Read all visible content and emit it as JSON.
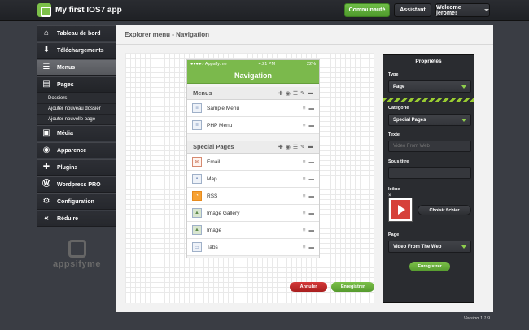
{
  "header": {
    "app_title": "My first IOS7 app",
    "community_label": "Communauté",
    "assistant_label": "Assistant",
    "welcome_label": "Welcome jerome!"
  },
  "sidebar": {
    "items": [
      {
        "label": "Tableau de bord",
        "icon": "home-icon"
      },
      {
        "label": "Téléchargements",
        "icon": "download-icon"
      },
      {
        "label": "Menus",
        "icon": "menu-icon"
      },
      {
        "label": "Pages",
        "icon": "page-icon"
      },
      {
        "label": "Média",
        "icon": "media-icon"
      },
      {
        "label": "Apparence",
        "icon": "palette-icon"
      },
      {
        "label": "Plugins",
        "icon": "puzzle-icon"
      },
      {
        "label": "Wordpress PRO",
        "icon": "wordpress-icon"
      },
      {
        "label": "Configuration",
        "icon": "gear-icon"
      },
      {
        "label": "Réduire",
        "icon": "collapse-icon"
      }
    ],
    "pages_sub": [
      "Dossiers",
      "Ajouter nouveau dossier",
      "Ajouter nouvelle page"
    ],
    "logo_text": "appsifyme"
  },
  "main": {
    "title": "Explorer menu - Navigation",
    "cancel_label": "Annuler",
    "save_label": "Enregistrer"
  },
  "phone": {
    "carrier": "●●●●○ Appsify.me",
    "time": "4:21 PM",
    "battery": "22%",
    "nav_title": "Navigation",
    "sections": [
      {
        "title": "Menus",
        "rows": [
          {
            "label": "Sample Menu",
            "icon": "page-icon"
          },
          {
            "label": "PHP Menu",
            "icon": "page-icon"
          }
        ]
      },
      {
        "title": "Special Pages",
        "rows": [
          {
            "label": "Email",
            "icon": "mail-icon"
          },
          {
            "label": "Map",
            "icon": "map-icon"
          },
          {
            "label": "RSS",
            "icon": "rss-icon"
          },
          {
            "label": "Image Gallery",
            "icon": "gallery-icon"
          },
          {
            "label": "Image",
            "icon": "image-icon"
          },
          {
            "label": "Tabs",
            "icon": "tabs-icon"
          }
        ]
      }
    ]
  },
  "properties": {
    "title": "Propriétés",
    "type_label": "Type",
    "type_value": "Page",
    "category_label": "Catégorie",
    "category_value": "Special Pages",
    "text_label": "Texte",
    "text_placeholder": "Video From Web",
    "subtitle_label": "Sous titre",
    "icon_label": "Icône",
    "icon_remove": "×",
    "choose_file_label": "Choisir fichier",
    "page_label": "Page",
    "page_value": "Video From The Web",
    "save_label": "Enregistrer"
  },
  "footer": {
    "version": "Version 1.1.9"
  },
  "colors": {
    "accent": "#7cc049",
    "danger": "#c42b2b",
    "dark": "#2a2c30"
  }
}
